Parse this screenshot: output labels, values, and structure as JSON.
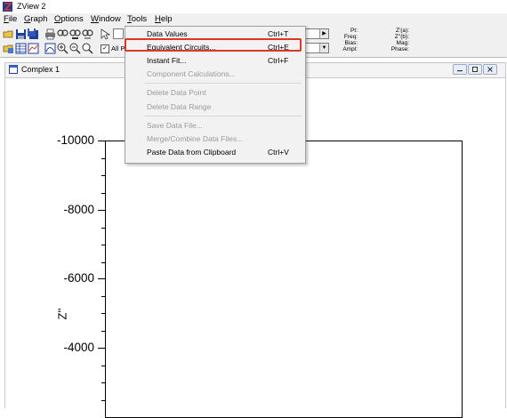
{
  "window": {
    "title": "ZView 2"
  },
  "menubar": {
    "items": [
      {
        "label": "File",
        "u": "F",
        "rest": "ile"
      },
      {
        "label": "Graph",
        "u": "G",
        "rest": "raph"
      },
      {
        "label": "Options",
        "u": "O",
        "rest": "ptions"
      },
      {
        "label": "Window",
        "u": "W",
        "rest": "indow"
      },
      {
        "label": "Tools",
        "u": "T",
        "rest": "ools"
      },
      {
        "label": "Help",
        "u": "H",
        "rest": "elp"
      }
    ]
  },
  "toolbar": {
    "all_checkbox_label": "All P",
    "readouts_left": [
      "Pt:",
      "Freq:",
      "Bias:",
      "Ampl:"
    ],
    "readouts_right": [
      "Z'(a):",
      "Z''(b):",
      "Mag:",
      "Phase:"
    ]
  },
  "child_window": {
    "title": "Complex 1"
  },
  "graph": {
    "y_axis_title": "Z''",
    "y_tick_labels": [
      "-10000",
      "-8000",
      "-6000",
      "-4000"
    ]
  },
  "tools_menu": {
    "items": [
      {
        "label": "Data Values",
        "shortcut": "Ctrl+T",
        "enabled": true
      },
      {
        "label": "Equivalent Circuits...",
        "shortcut": "Ctrl+E",
        "enabled": true,
        "highlighted": true
      },
      {
        "label": "Instant Fit...",
        "shortcut": "Ctrl+F",
        "enabled": true
      },
      {
        "label": "Component Calculations...",
        "shortcut": "",
        "enabled": false
      },
      {
        "label": "Delete Data Point",
        "shortcut": "",
        "enabled": false
      },
      {
        "label": "Delete Data Range",
        "shortcut": "",
        "enabled": false
      },
      {
        "label": "Save Data File...",
        "shortcut": "",
        "enabled": false
      },
      {
        "label": "Merge/Combine Data Files...",
        "shortcut": "",
        "enabled": false
      },
      {
        "label": "Paste Data from Clipboard",
        "shortcut": "Ctrl+V",
        "enabled": true
      }
    ]
  },
  "colors": {
    "highlight_border": "#e0362a",
    "menu_bg": "#f2f2f2",
    "disabled_text": "#9a9a9a"
  }
}
